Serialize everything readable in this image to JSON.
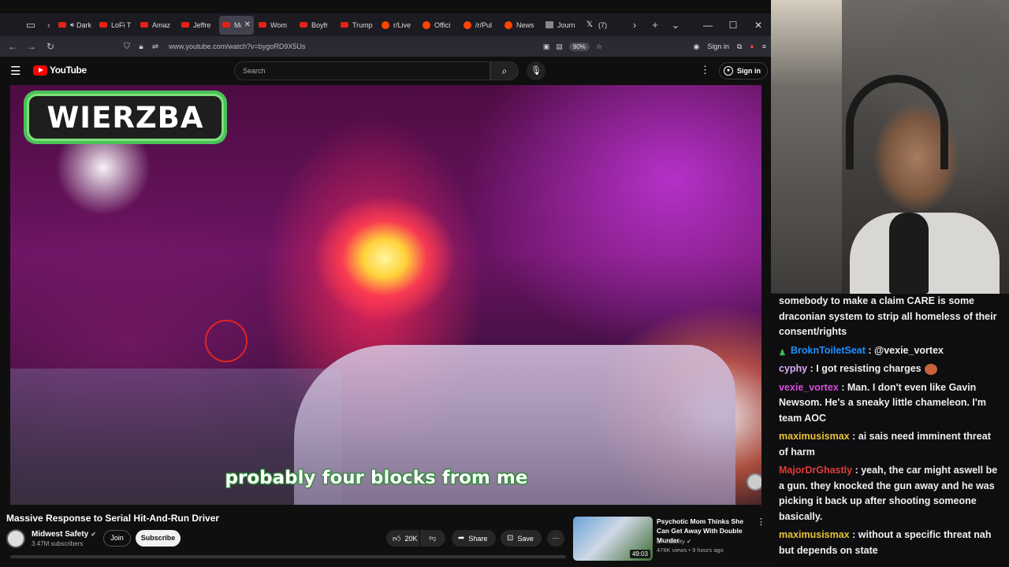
{
  "browser": {
    "tabs": [
      {
        "label": "Dark S",
        "favicon": "youtube",
        "active": false,
        "audio": true
      },
      {
        "label": "LoFi T",
        "favicon": "youtube",
        "active": false
      },
      {
        "label": "Amaz",
        "favicon": "youtube",
        "active": false
      },
      {
        "label": "Jeffre",
        "favicon": "youtube",
        "active": false
      },
      {
        "label": "Ma",
        "favicon": "youtube",
        "active": true
      },
      {
        "label": "Wom",
        "favicon": "youtube",
        "active": false
      },
      {
        "label": "Boyfr",
        "favicon": "youtube",
        "active": false
      },
      {
        "label": "Trump",
        "favicon": "youtube",
        "active": false
      },
      {
        "label": "r/Live",
        "favicon": "reddit",
        "active": false
      },
      {
        "label": "Offici",
        "favicon": "reddit",
        "active": false
      },
      {
        "label": "/r/Pul",
        "favicon": "reddit",
        "active": false
      },
      {
        "label": "News",
        "favicon": "reddit",
        "active": false
      },
      {
        "label": "Journ",
        "favicon": "doc",
        "active": false
      },
      {
        "label": "(7)",
        "favicon": "x",
        "active": false
      }
    ],
    "url": "www.youtube.com/watch?v=bygoRD9X5Us",
    "zoom": "90%",
    "sign_in": "Sign in"
  },
  "youtube": {
    "logo_text": "YouTube",
    "search_placeholder": "Search",
    "sign_in": "Sign in",
    "video": {
      "overlay_title": "WIERZBA",
      "caption": "probably four blocks from me",
      "title": "Massive Response to Serial Hit-And-Run Driver"
    },
    "channel": {
      "name": "Midwest Safety",
      "subscribers": "3.47M subscribers",
      "join": "Join",
      "subscribe": "Subscribe"
    },
    "actions": {
      "likes": "20K",
      "share": "Share",
      "save": "Save"
    },
    "recommendation": {
      "title": "Psychotic Mom Thinks She Can Get Away With Double Murder",
      "channel": "Dr Insanity",
      "meta": "478K views • 9 hours ago",
      "duration": "49:03"
    }
  },
  "chat": {
    "messages": [
      {
        "user": "",
        "user_color": "#efeff1",
        "text": "somebody to make a claim CARE is some draconian system to strip all homeless of their consent/rights"
      },
      {
        "user": "BroknToiletSeat",
        "user_color": "#1e90ff",
        "text": "@vexie_vortex",
        "badges": true
      },
      {
        "user": "cyphy",
        "user_color": "#daa9f5",
        "text": "I got resisting charges",
        "emote": true
      },
      {
        "user": "vexie_vortex",
        "user_color": "#d44dd8",
        "text": "Man. I don't even like Gavin Newsom. He's a sneaky little chameleon. I'm team AOC"
      },
      {
        "user": "maximusismax",
        "user_color": "#e8c23a",
        "text": "ai sais need imminent threat of harm"
      },
      {
        "user": "MajorDrGhastly",
        "user_color": "#e03a3a",
        "text": "yeah, the car might aswell be a gun. they knocked the gun away and he was picking it back up after shooting someone basically."
      },
      {
        "user": "maximusismax",
        "user_color": "#e8c23a",
        "text": "without a specific threat nah but depends on state"
      }
    ]
  }
}
